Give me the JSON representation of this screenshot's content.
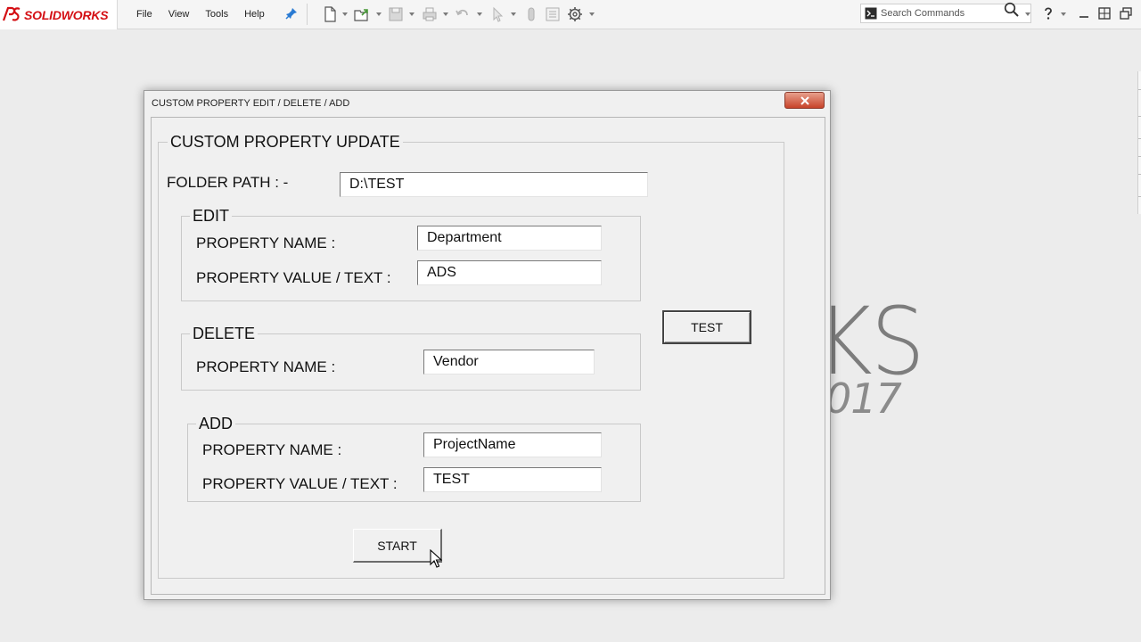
{
  "app": {
    "brand": "SOLIDWORKS",
    "brand_color": "#d40f14",
    "menu": [
      "File",
      "View",
      "Tools",
      "Help"
    ],
    "search_placeholder": "Search Commands",
    "toolbar_icons": [
      "new-document-icon",
      "open-icon",
      "save-icon",
      "print-icon",
      "undo-icon",
      "select-icon",
      "rebuild-icon",
      "file-properties-icon",
      "options-icon"
    ],
    "watermark": {
      "big": "KS",
      "year": "017"
    }
  },
  "dialog": {
    "title": "CUSTOM PROPERTY EDIT / DELETE / ADD",
    "group_title": "CUSTOM PROPERTY UPDATE",
    "folder_path_label": "FOLDER PATH : -",
    "folder_path_value": "D:\\TEST",
    "edit": {
      "title": "EDIT",
      "name_label": "PROPERTY NAME :",
      "name_value": "Department",
      "value_label": "PROPERTY VALUE / TEXT :",
      "value_value": "ADS"
    },
    "delete": {
      "title": "DELETE",
      "name_label": "PROPERTY NAME :",
      "name_value": "Vendor"
    },
    "add": {
      "title": "ADD",
      "name_label": "PROPERTY NAME :",
      "name_value": "ProjectName",
      "value_label": "PROPERTY VALUE / TEXT :",
      "value_value": "TEST"
    },
    "test_button": "TEST",
    "start_button": "START"
  }
}
